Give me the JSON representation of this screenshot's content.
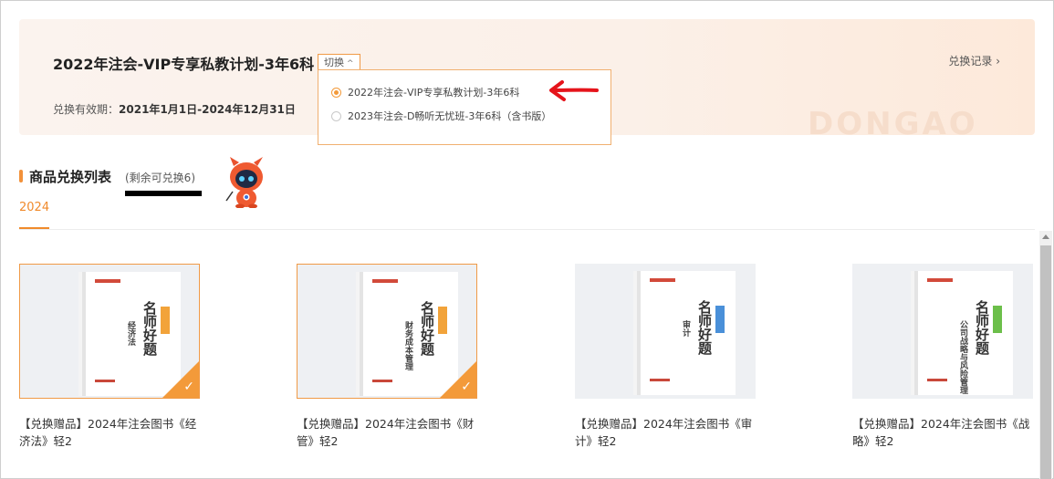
{
  "header": {
    "plan_title": "2022年注会-VIP专享私教计划-3年6科",
    "switch_label": "切换",
    "history_label": "兑换记录",
    "validity_label": "兑换有效期：",
    "validity_value": "2021年1月1日-2024年12月31日",
    "watermark": "DONGAO"
  },
  "dropdown": {
    "options": [
      {
        "label": "2022年注会-VIP专享私教计划-3年6科",
        "selected": true
      },
      {
        "label": "2023年注会-D畅听无忧班-3年6科（含书版）",
        "selected": false
      }
    ]
  },
  "section": {
    "title": "商品兑换列表",
    "remaining": "(剩余可兑换6)"
  },
  "tabs": [
    {
      "label": "2024",
      "active": true
    }
  ],
  "products": [
    {
      "name": "【兑换赠品】2024年注会图书《经济法》轻2",
      "book_title": "名师好题",
      "book_subject": "经济法",
      "accent": "#f2a33a",
      "selected": true
    },
    {
      "name": "【兑换赠品】2024年注会图书《财管》轻2",
      "book_title": "名师好题",
      "book_subject": "财务成本管理",
      "accent": "#f2a33a",
      "selected": true
    },
    {
      "name": "【兑换赠品】2024年注会图书《审计》轻2",
      "book_title": "名师好题",
      "book_subject": "审计",
      "accent": "#4a90d9",
      "selected": false
    },
    {
      "name": "【兑换赠品】2024年注会图书《战略》轻2",
      "book_title": "名师好题",
      "book_subject": "公司战略与风险管理",
      "accent": "#6cbf4a",
      "selected": false
    }
  ],
  "colors": {
    "accent": "#f08a2b",
    "selected_border": "#f09a46"
  }
}
